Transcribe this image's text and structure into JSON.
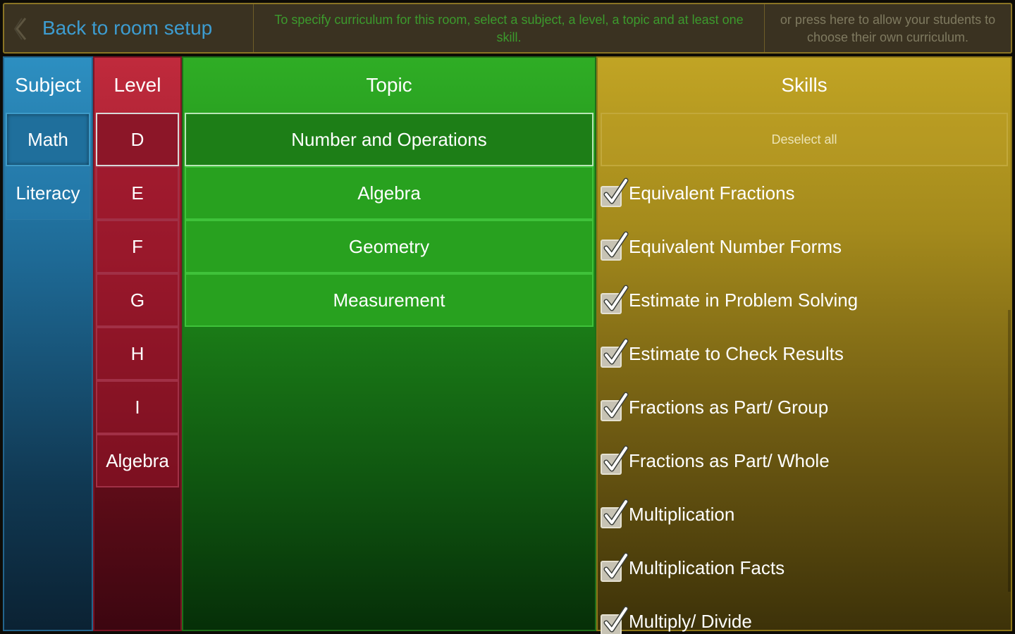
{
  "topbar": {
    "back_label": "Back to room setup",
    "instructions": "To specify curriculum for this room, select a subject, a level, a topic and at least one skill.",
    "own_curriculum": "or press here to allow your students to choose their own curriculum."
  },
  "subject": {
    "header": "Subject",
    "items": [
      {
        "label": "Math",
        "selected": true
      },
      {
        "label": "Literacy",
        "selected": false
      }
    ]
  },
  "level": {
    "header": "Level",
    "items": [
      {
        "label": "D",
        "selected": true
      },
      {
        "label": "E",
        "selected": false
      },
      {
        "label": "F",
        "selected": false
      },
      {
        "label": "G",
        "selected": false
      },
      {
        "label": "H",
        "selected": false
      },
      {
        "label": "I",
        "selected": false
      },
      {
        "label": "Algebra",
        "selected": false
      }
    ]
  },
  "topic": {
    "header": "Topic",
    "items": [
      {
        "label": "Number and Operations",
        "selected": true
      },
      {
        "label": "Algebra",
        "selected": false
      },
      {
        "label": "Geometry",
        "selected": false
      },
      {
        "label": "Measurement",
        "selected": false
      }
    ]
  },
  "skills": {
    "header": "Skills",
    "deselect_label": "Deselect all",
    "items": [
      {
        "label": "Equivalent Fractions",
        "checked": true
      },
      {
        "label": "Equivalent Number Forms",
        "checked": true
      },
      {
        "label": "Estimate in Problem Solving",
        "checked": true
      },
      {
        "label": "Estimate to Check Results",
        "checked": true
      },
      {
        "label": "Fractions as Part/ Group",
        "checked": true
      },
      {
        "label": "Fractions as Part/ Whole",
        "checked": true
      },
      {
        "label": "Multiplication",
        "checked": true
      },
      {
        "label": "Multiplication Facts",
        "checked": true
      },
      {
        "label": "Multiply/ Divide",
        "checked": true
      }
    ]
  },
  "icons": {
    "back": "chevron-left-icon",
    "check": "checkmark-icon"
  },
  "colors": {
    "subject": "#1e6a96",
    "level": "#9d1d2f",
    "topic": "#1f8c1a",
    "skills": "#a48a1c",
    "back_text": "#3d9cd0",
    "instructions_text": "#3c9a2d"
  }
}
